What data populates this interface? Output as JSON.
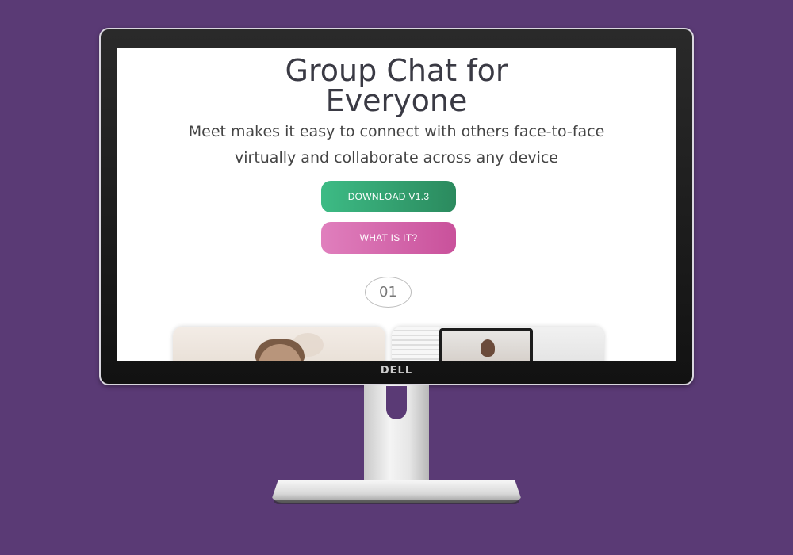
{
  "hero": {
    "title_line1": "Group Chat for",
    "title_line2": "Everyone",
    "subtitle_line1": "Meet makes it easy to connect with others face-to-face",
    "subtitle_line2": "virtually and collaborate across any device"
  },
  "buttons": {
    "download_label": "DOWNLOAD V1.3",
    "what_label": "WHAT IS IT?"
  },
  "pagination": {
    "current": "01"
  },
  "monitor": {
    "brand": "DELL"
  },
  "colors": {
    "background": "#5a3a75",
    "download_button": "#3dbb85",
    "what_button": "#e07fbd",
    "title_text": "#3a3a44"
  }
}
